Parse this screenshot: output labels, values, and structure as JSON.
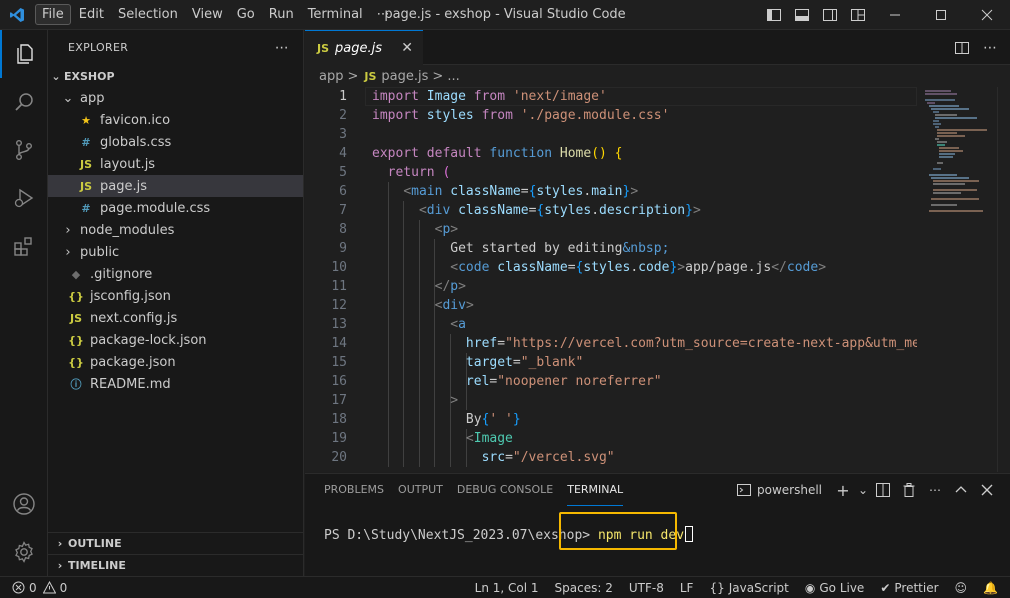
{
  "titlebar": {
    "menu": [
      "File",
      "Edit",
      "Selection",
      "View",
      "Go",
      "Run",
      "Terminal",
      "⋯"
    ],
    "title": "page.js - exshop - Visual Studio Code"
  },
  "sidebar": {
    "header": "EXPLORER",
    "more": "⋯",
    "project": "EXSHOP",
    "items": [
      {
        "label": "app",
        "type": "folder-open",
        "indent": 1
      },
      {
        "label": "favicon.ico",
        "type": "star",
        "indent": 2
      },
      {
        "label": "globals.css",
        "type": "css",
        "indent": 2
      },
      {
        "label": "layout.js",
        "type": "js",
        "indent": 2
      },
      {
        "label": "page.js",
        "type": "js",
        "indent": 2,
        "selected": true
      },
      {
        "label": "page.module.css",
        "type": "css",
        "indent": 2
      },
      {
        "label": "node_modules",
        "type": "folder",
        "indent": 1
      },
      {
        "label": "public",
        "type": "folder",
        "indent": 1
      },
      {
        "label": ".gitignore",
        "type": "git",
        "indent": 1
      },
      {
        "label": "jsconfig.json",
        "type": "json",
        "indent": 1
      },
      {
        "label": "next.config.js",
        "type": "js",
        "indent": 1
      },
      {
        "label": "package-lock.json",
        "type": "json",
        "indent": 1
      },
      {
        "label": "package.json",
        "type": "json",
        "indent": 1
      },
      {
        "label": "README.md",
        "type": "info",
        "indent": 1
      }
    ],
    "outline": "OUTLINE",
    "timeline": "TIMELINE"
  },
  "editor": {
    "tab": {
      "badge": "JS",
      "label": "page.js",
      "close": "✕"
    },
    "breadcrumb": {
      "folder": "app",
      "sep": ">",
      "badge": "JS",
      "file": "page.js",
      "more": "..."
    },
    "current_line": 1,
    "lines": [
      {
        "n": "1",
        "html": "<span class='k'>import</span> <span class='v'>Image</span> <span class='k'>from</span> <span class='s'>'next/image'</span>"
      },
      {
        "n": "2",
        "html": "<span class='k'>import</span> <span class='v'>styles</span> <span class='k'>from</span> <span class='s'>'./page.module.css'</span>"
      },
      {
        "n": "3",
        "html": ""
      },
      {
        "n": "4",
        "html": "<span class='k'>export</span> <span class='k'>default</span> <span class='kb'>function</span> <span class='f'>Home</span><span class='by'>()</span> <span class='by'>{</span>"
      },
      {
        "n": "5",
        "html": "  <span class='k'>return</span> <span class='br'>(</span>"
      },
      {
        "n": "6",
        "html": "    <span class='g'>&lt;</span><span class='kb'>main</span> <span class='v'>className</span>=<span class='bb'>{</span><span class='v'>styles</span>.<span class='v'>main</span><span class='bb'>}</span><span class='g'>&gt;</span>"
      },
      {
        "n": "7",
        "html": "      <span class='g'>&lt;</span><span class='kb'>div</span> <span class='v'>className</span>=<span class='bb'>{</span><span class='v'>styles</span>.<span class='v'>description</span><span class='bb'>}</span><span class='g'>&gt;</span>"
      },
      {
        "n": "8",
        "html": "        <span class='g'>&lt;</span><span class='kb'>p</span><span class='g'>&gt;</span>"
      },
      {
        "n": "9",
        "html": "          Get started by editing<span class='kb'>&amp;nbsp;</span>"
      },
      {
        "n": "10",
        "html": "          <span class='g'>&lt;</span><span class='kb'>code</span> <span class='v'>className</span>=<span class='bb'>{</span><span class='v'>styles</span>.<span class='v'>code</span><span class='bb'>}</span><span class='g'>&gt;</span>app/page.js<span class='g'>&lt;/</span><span class='kb'>code</span><span class='g'>&gt;</span>"
      },
      {
        "n": "11",
        "html": "        <span class='g'>&lt;/</span><span class='kb'>p</span><span class='g'>&gt;</span>"
      },
      {
        "n": "12",
        "html": "        <span class='g'>&lt;</span><span class='kb'>div</span><span class='g'>&gt;</span>"
      },
      {
        "n": "13",
        "html": "          <span class='g'>&lt;</span><span class='kb'>a</span>"
      },
      {
        "n": "14",
        "html": "            <span class='v'>href</span>=<span class='s'>\"https://vercel.com?utm_source=create-next-app&amp;utm_med</span>"
      },
      {
        "n": "15",
        "html": "            <span class='v'>target</span>=<span class='s'>\"_blank\"</span>"
      },
      {
        "n": "16",
        "html": "            <span class='v'>rel</span>=<span class='s'>\"noopener noreferrer\"</span>"
      },
      {
        "n": "17",
        "html": "          <span class='g'>&gt;</span>"
      },
      {
        "n": "18",
        "html": "            By<span class='bb'>{</span><span class='s'>' '</span><span class='bb'>}</span>"
      },
      {
        "n": "19",
        "html": "            <span class='g'>&lt;</span><span class='t'>Image</span>"
      },
      {
        "n": "20",
        "html": "              <span class='v'>src</span>=<span class='s'>\"/vercel.svg\"</span>"
      }
    ]
  },
  "panel": {
    "tabs": [
      "PROBLEMS",
      "OUTPUT",
      "DEBUG CONSOLE",
      "TERMINAL"
    ],
    "active_tab": "TERMINAL",
    "shell": "powershell",
    "prompt": "PS D:\\Study\\NextJS_2023.07\\exshop> ",
    "command": "npm run dev"
  },
  "statusbar": {
    "errors": "0",
    "warnings": "0",
    "position": "Ln 1, Col 1",
    "spaces": "Spaces: 2",
    "encoding": "UTF-8",
    "eol": "LF",
    "language": "JavaScript",
    "golive": "Go Live",
    "prettier": "Prettier"
  },
  "colors": {
    "accent": "#0078d4",
    "highlight": "#f5b800",
    "js_badge": "#cbcb41"
  }
}
